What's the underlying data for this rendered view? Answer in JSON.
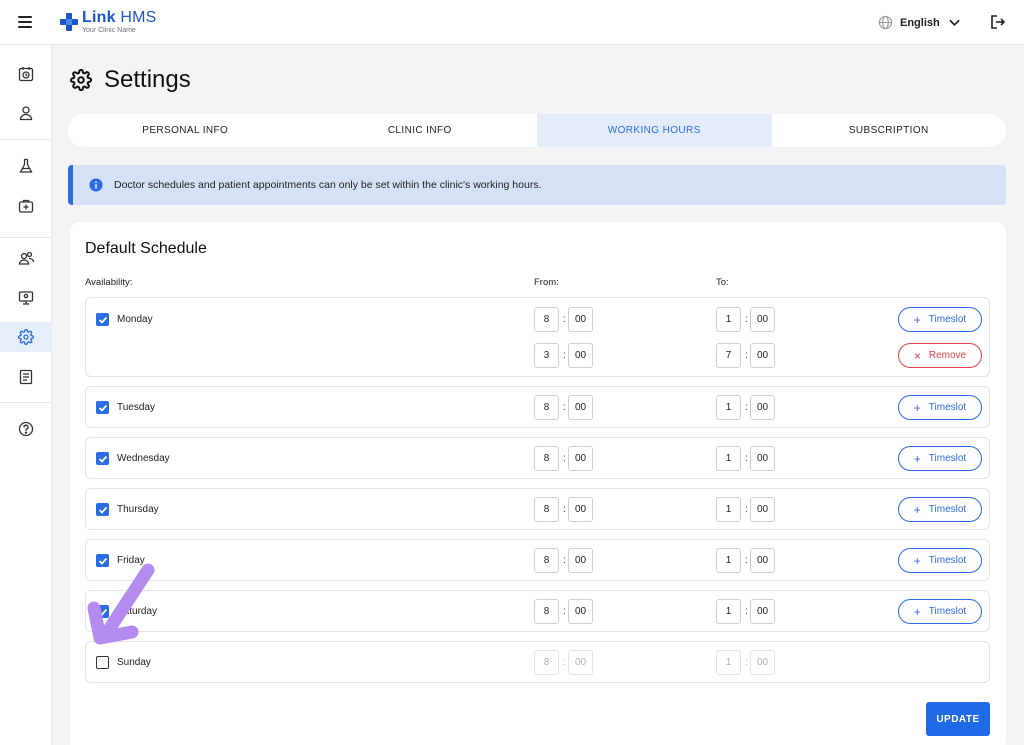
{
  "header": {
    "brand_bold": "Link",
    "brand_rest": "HMS",
    "brand_sub": "Your Clinic Name",
    "language": "English"
  },
  "page": {
    "title": "Settings"
  },
  "tabs": [
    {
      "label": "PERSONAL INFO"
    },
    {
      "label": "CLINIC INFO"
    },
    {
      "label": "WORKING HOURS",
      "active": true
    },
    {
      "label": "SUBSCRIPTION"
    }
  ],
  "banner": {
    "text": "Doctor schedules and patient appointments can only be set within the clinic's working hours."
  },
  "schedule": {
    "title": "Default Schedule",
    "col_availability": "Availability:",
    "col_from": "From:",
    "col_to": "To:",
    "timeslot_label": "Timeslot",
    "remove_label": "Remove",
    "days": [
      {
        "name": "Monday",
        "checked": true,
        "slots": [
          {
            "from_h": "8",
            "from_m": "00",
            "to_h": "1",
            "to_m": "00"
          },
          {
            "from_h": "3",
            "from_m": "00",
            "to_h": "7",
            "to_m": "00"
          }
        ]
      },
      {
        "name": "Tuesday",
        "checked": true,
        "slots": [
          {
            "from_h": "8",
            "from_m": "00",
            "to_h": "1",
            "to_m": "00"
          }
        ]
      },
      {
        "name": "Wednesday",
        "checked": true,
        "slots": [
          {
            "from_h": "8",
            "from_m": "00",
            "to_h": "1",
            "to_m": "00"
          }
        ]
      },
      {
        "name": "Thursday",
        "checked": true,
        "slots": [
          {
            "from_h": "8",
            "from_m": "00",
            "to_h": "1",
            "to_m": "00"
          }
        ]
      },
      {
        "name": "Friday",
        "checked": true,
        "slots": [
          {
            "from_h": "8",
            "from_m": "00",
            "to_h": "1",
            "to_m": "00"
          }
        ]
      },
      {
        "name": "Saturday",
        "checked": true,
        "slots": [
          {
            "from_h": "8",
            "from_m": "00",
            "to_h": "1",
            "to_m": "00"
          }
        ]
      },
      {
        "name": "Sunday",
        "checked": false,
        "slots": [
          {
            "from_h": "8",
            "from_m": "00",
            "to_h": "1",
            "to_m": "00"
          }
        ]
      }
    ]
  },
  "actions": {
    "update_label": "UPDATE"
  },
  "colors": {
    "primary": "#2b6be3",
    "danger": "#e0404a",
    "annotation": "#b48cf0"
  },
  "icons": {
    "sidebar": [
      "calendar-icon",
      "user-icon",
      "lab-flask-icon",
      "medical-kit-icon",
      "users-icon",
      "monitor-icon",
      "gear-icon",
      "report-icon",
      "help-icon"
    ]
  }
}
